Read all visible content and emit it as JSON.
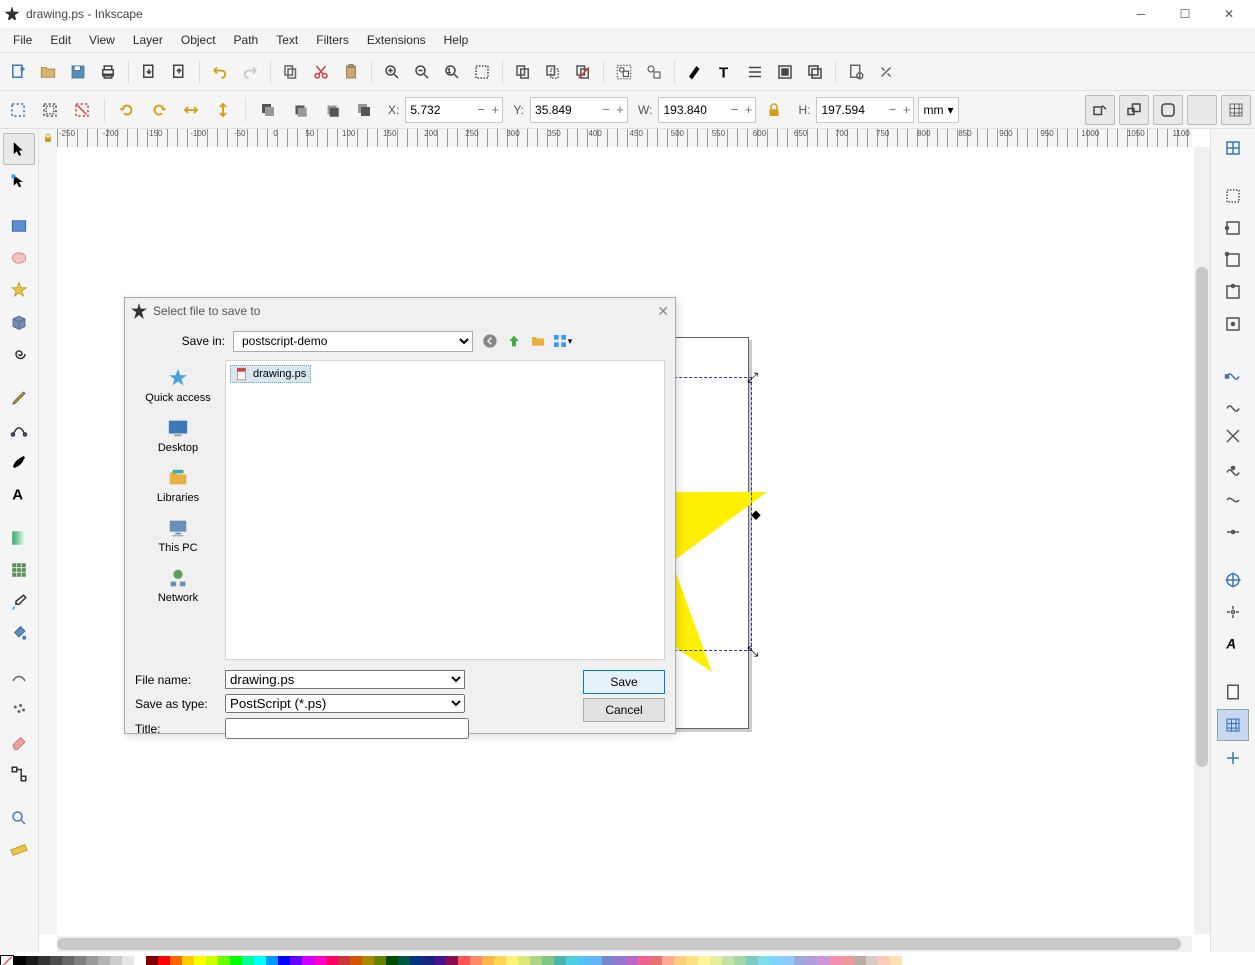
{
  "window": {
    "title": "drawing.ps - Inkscape"
  },
  "menu": [
    "File",
    "Edit",
    "View",
    "Layer",
    "Object",
    "Path",
    "Text",
    "Filters",
    "Extensions",
    "Help"
  ],
  "coords": {
    "x_label": "X:",
    "x": "5.732",
    "y_label": "Y:",
    "y": "35.849",
    "w_label": "W:",
    "w": "193.840",
    "h_label": "H:",
    "h": "197.594",
    "units": "mm"
  },
  "ruler_ticks": [
    "-250",
    "-200",
    "-150",
    "-100",
    "-50",
    "0",
    "50",
    "100",
    "150",
    "200",
    "250",
    "300",
    "350",
    "400",
    "450",
    "500",
    "550",
    "600",
    "650",
    "700",
    "750",
    "800",
    "850",
    "900",
    "950",
    "1000",
    "1050",
    "1100"
  ],
  "dialog": {
    "title": "Select file to save to",
    "save_in_label": "Save in:",
    "save_in_value": "postscript-demo",
    "file_item": "drawing.ps",
    "places": {
      "quick": "Quick access",
      "desktop": "Desktop",
      "libraries": "Libraries",
      "thispc": "This PC",
      "network": "Network"
    },
    "file_name_label": "File name:",
    "file_name_value": "drawing.ps",
    "save_as_type_label": "Save as type:",
    "save_as_type_value": "PostScript (*.ps)",
    "title_label": "Title:",
    "title_value": "",
    "save_btn": "Save",
    "cancel_btn": "Cancel"
  },
  "palette": [
    "#000000",
    "#1a1a1a",
    "#333333",
    "#4d4d4d",
    "#666666",
    "#808080",
    "#999999",
    "#b3b3b3",
    "#cccccc",
    "#e6e6e6",
    "#ffffff",
    "#800000",
    "#ff0000",
    "#ff6600",
    "#ffcc00",
    "#ffff00",
    "#ccff00",
    "#66ff00",
    "#00ff00",
    "#00ff99",
    "#00ffff",
    "#0099ff",
    "#0000ff",
    "#6600ff",
    "#cc00ff",
    "#ff00cc",
    "#ff0066",
    "#c83737",
    "#d45500",
    "#aa8800",
    "#668000",
    "#004d00",
    "#005544",
    "#003380",
    "#1a237e",
    "#4a148c",
    "#880e4f",
    "#ff5252",
    "#ff8a65",
    "#ffb74d",
    "#ffd54f",
    "#fff176",
    "#dce775",
    "#aed581",
    "#81c784",
    "#4db6ac",
    "#4dd0e1",
    "#4fc3f7",
    "#64b5f6",
    "#7986cb",
    "#9575cd",
    "#ba68c8",
    "#f06292",
    "#e57373",
    "#ffab91",
    "#ffcc80",
    "#ffe082",
    "#fff59d",
    "#e6ee9c",
    "#c5e1a5",
    "#a5d6a7",
    "#80cbc4",
    "#80deea",
    "#81d4fa",
    "#90caf9",
    "#9fa8da",
    "#b39ddb",
    "#ce93d8",
    "#f48fb1",
    "#ef9a9a",
    "#bcaaa4",
    "#d7ccc8",
    "#ffccbc",
    "#ffe0b2"
  ]
}
